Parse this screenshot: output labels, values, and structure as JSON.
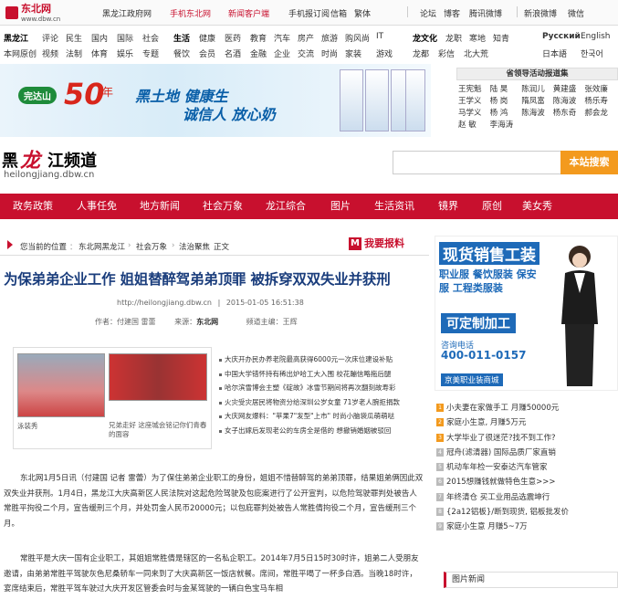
{
  "topbar": {
    "logo_text": "东北网",
    "logo_url": "www.dbw.cn",
    "links": [
      "黑龙江政府网",
      "手机东北网",
      "新闻客户端",
      "手机报订阅",
      "信箱",
      "繁体",
      "论坛",
      "博客",
      "腾讯微博",
      "新浪微博",
      "微信"
    ]
  },
  "navrows": {
    "row1_label": "黑龙江",
    "row1": [
      "评论",
      "民生",
      "国内",
      "国际",
      "社会"
    ],
    "row1b_label": "生活",
    "row1b": [
      "健康",
      "医药",
      "教育",
      "汽车",
      "房产",
      "旅游",
      "购风尚",
      "IT"
    ],
    "row1c_label": "龙文化",
    "row1c": [
      "龙职",
      "寒地",
      "知青"
    ],
    "row2": [
      "本网原创",
      "视频",
      "法制",
      "体育",
      "娱乐",
      "专题",
      "餐饮",
      "会员",
      "名酒",
      "金融",
      "企业",
      "交流",
      "时尚",
      "家装",
      "游戏",
      "龙都",
      "彩信",
      "北大荒"
    ],
    "lang": [
      "Русский",
      "English",
      "日本語",
      "한국어"
    ]
  },
  "banner": {
    "brand": "完达山",
    "num": "50",
    "nian": "年",
    "slogan1": "黑土地 健康生",
    "slogan2": "诚信人 放心奶"
  },
  "leader": {
    "title": "省领导活动报道集",
    "names": [
      "王宪魁",
      "陆 昊",
      "陈润儿",
      "黄建盛",
      "张效廉",
      "王学义",
      "杨 岗",
      "隋凤富",
      "陈海波",
      "杨乐寿",
      "马学义",
      "杨 鸿",
      "陈海波",
      "杨东奇",
      "郝会龙",
      "赵 敏",
      "李海涛"
    ]
  },
  "channel": {
    "a": "黑",
    "b": "龙",
    "c": "江频道",
    "url": "heilongjiang.dbw.cn",
    "search_btn": "本站搜索"
  },
  "mainnav": [
    "政务政策",
    "人事任免",
    "地方新闻",
    "社会万象",
    "龙江综合",
    "图片",
    "生活资讯",
    "镜界",
    "原创",
    "美女秀"
  ],
  "breadcrumb": {
    "lead": "您当前的位置",
    "items": [
      "东北网黑龙江",
      "社会万象",
      "法治聚焦",
      "正文"
    ],
    "report": "我要报料"
  },
  "article": {
    "title": "为保弟弟企业工作 姐姐替醉驾弟弟顶罪 被拆穿双双失业并获刑",
    "url": "http://heilongjiang.dbw.cn",
    "date": "2015-01-05 16:51:38",
    "author_label": "作者：",
    "author": "付建国 雷蕾",
    "source_label": "来源：",
    "source": "东北网",
    "editor_label": "频道主编：",
    "editor": "王辉",
    "para1": "东北网1月5日讯（付建国 记者 雷蕾）为了保住弟弟企业职工的身份，姐姐不惜替醉驾的弟弟顶罪，结果姐弟俩因此双双失业并获刑。1月4日，黑龙江大庆高新区人民法院对这起危险驾驶及包庇案进行了公开宣判，以危险驾驶罪判处被告人常胜平拘役二个月，宣告缓刑三个月，并处罚金人民币20000元；以包庇罪判处被告人常胜倩拘役二个月，宣告缓刑三个月。",
    "para2": "常胜平是大庆一国有企业职工，其姐姐常胜倩是辖区的一名私企职工。2014年7月5日15时30时许，姐弟二人受朋友邀请，由弟弟常胜平驾驶灰色尼桑轿车一同来到了大庆高新区一饭店就餐。席间，常胜平喝了一杯多白酒。当晚18时许，宴席结束后，常胜平驾车驶过大庆开发区管委会时与金某驾驶的一辆白色宝马车相"
  },
  "pictures": [
    {
      "cap": "泳装秀"
    },
    {
      "cap": "兄弟走好 这座城会铭记你们青春的面容"
    }
  ],
  "related": [
    "大庆开办民办养老院最高获得6000元一次床位建设补贴",
    "中国大学错怀持有稀出炉哈工大入围 校花蹦信略拖后腿",
    "哈尔滨雪博会主塑《碇故》冰雪节期间将再次翻刻故寿彩",
    "火灾受灾居民将物资分给深圳公岁女童 71岁老人腕拒捐款",
    "大庆网友爆料：\"苹果7\"发型\"上市\" 时尚小脑袋瓜萌萌哒",
    "女子出嫁后发现老公的车房全是借的 想撤销婚姻被驳回"
  ],
  "ad": {
    "h1": "现货销售工装",
    "h2": "职业服 餐饮服装 保安服 工程类服装",
    "h3": "可定制加工",
    "h4": "咨询电话",
    "h5": "400-011-0157",
    "h6": "京美职业装商城"
  },
  "hotlist": [
    "小夫妻在家做手工 月赚50000元",
    "家庭小生意, 月赚5万元",
    "大学毕业了很迷茫?找不到工作?",
    "冠舟(滤清器) 国际品质厂家直销",
    "机动车年检一安泰达汽车管家",
    "2015想赚钱就做特色生意>>>",
    "年终清仓 买工业用品选震坤行",
    "{2a12铝板}/断到现货, 铝板批发价",
    "家庭小生意 月赚5~7万"
  ],
  "picnews_title": "图片新闻"
}
